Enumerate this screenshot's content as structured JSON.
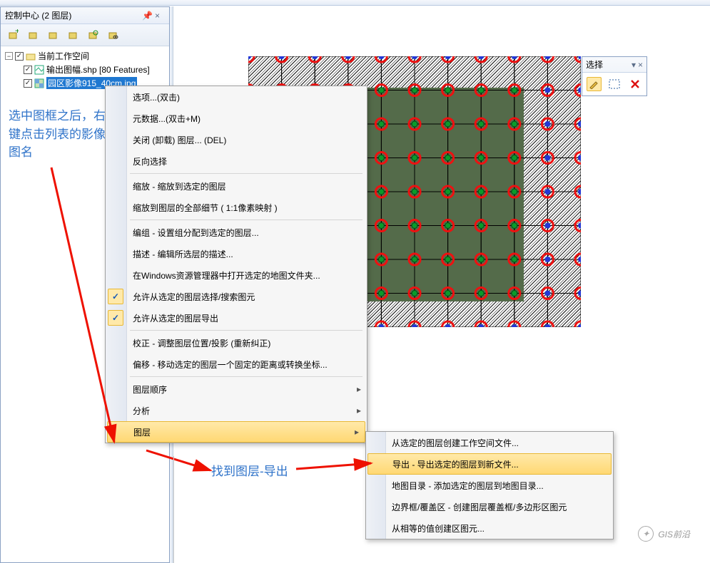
{
  "panel": {
    "title": "控制中心 (2 图层)",
    "pin_glyph": "📌",
    "close_glyph": "×",
    "tree": {
      "root": "当前工作空间",
      "layer1": "输出图幅.shp [80 Features]",
      "layer2": "园区影像915_40cm.jpg",
      "minus": "−",
      "check": "✓"
    }
  },
  "sel": {
    "title": "选择",
    "pin_glyph": "▾",
    "close_glyph": "×"
  },
  "ctx": {
    "items": [
      "选项...(双击)",
      "元数据...(双击+M)",
      "关闭 (卸载) 图层... (DEL)",
      "反向选择",
      "缩放 - 缩放到选定的图层",
      "缩放到图层的全部细节 ( 1:1像素映射 )",
      "编组 - 设置组分配到选定的图层...",
      "描述 - 编辑所选层的描述...",
      "在Windows资源管理器中打开选定的地图文件夹...",
      "允许从选定的图层选择/搜索图元",
      "允许从选定的图层导出",
      "校正 - 调整图层位置/投影 (重新纠正)",
      "偏移 - 移动选定的图层一个固定的距离或转换坐标...",
      "图层顺序",
      "分析",
      "图层"
    ],
    "check_glyph": "✓"
  },
  "sub": {
    "items": [
      "从选定的图层创建工作空间文件...",
      "导出 - 导出选定的图层到新文件...",
      "地图目录 - 添加选定的图层到地图目录...",
      "边界框/覆盖区 - 创建图层覆盖框/多边形区图元",
      "从相等的值创建区图元..."
    ]
  },
  "annot": {
    "line1": "选中图框之后，右键点击列表的影像图名",
    "line2": "找到图层-导出"
  },
  "watermark": "GIS前沿"
}
